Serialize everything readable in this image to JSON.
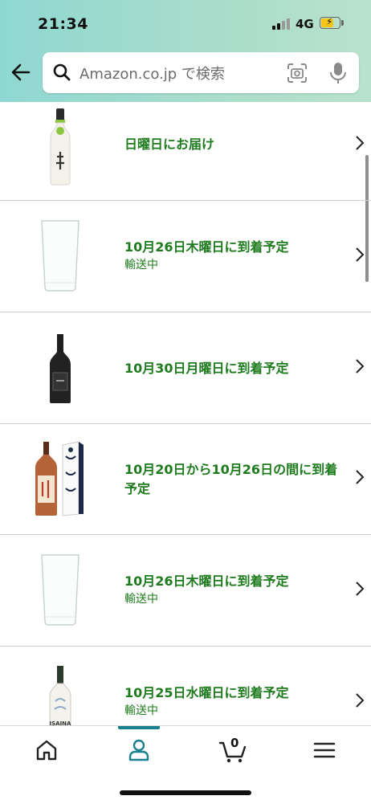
{
  "status_bar": {
    "time": "21:34",
    "network": "4G"
  },
  "search": {
    "placeholder": "Amazon.co.jp で検索"
  },
  "orders": [
    {
      "delivery": "日曜日にお届け",
      "status": "",
      "product": "sake-bottle-white"
    },
    {
      "delivery": "10月26日木曜日に到着予定",
      "status": "輸送中",
      "product": "drinking-glass"
    },
    {
      "delivery": "10月30日月曜日に到着予定",
      "status": "",
      "product": "shochu-bottle-black"
    },
    {
      "delivery": "10月20日から10月26日の間に到着予定",
      "status": "",
      "product": "umeshu-bottle-with-box"
    },
    {
      "delivery": "10月26日木曜日に到着予定",
      "status": "輸送中",
      "product": "drinking-glass"
    },
    {
      "delivery": "10月25日水曜日に到着予定",
      "status": "輸送中",
      "product": "isaina-bottle",
      "product_label": "ISAINA"
    }
  ],
  "tabbar": {
    "cart_count": "0",
    "active_tab": "account"
  },
  "colors": {
    "header_gradient_start": "#8fd8d2",
    "header_gradient_end": "#b9e2cc",
    "delivery_text": "#1e7b1e",
    "active_tab": "#1a7f8f"
  }
}
